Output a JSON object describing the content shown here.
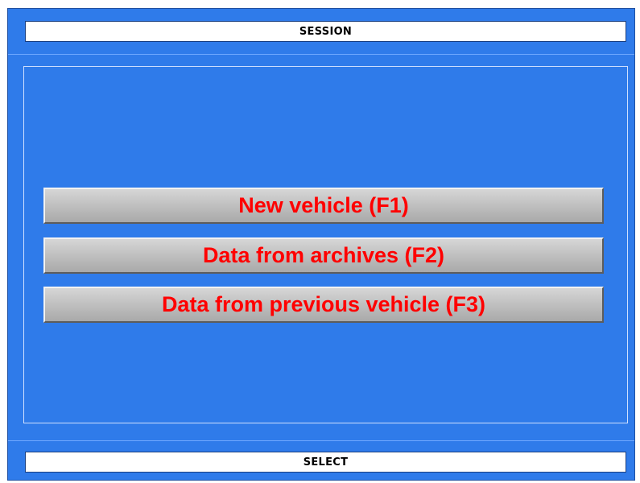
{
  "header": {
    "title": "SESSION"
  },
  "menu": {
    "items": [
      {
        "label": "New vehicle (F1)"
      },
      {
        "label": "Data from archives (F2)"
      },
      {
        "label": "Data from previous vehicle (F3)"
      }
    ]
  },
  "footer": {
    "status": "SELECT"
  },
  "colors": {
    "background": "#2f7bea",
    "button_text": "#ff0000",
    "button_face": "#c0c0c0",
    "bar_background": "#ffffff"
  }
}
